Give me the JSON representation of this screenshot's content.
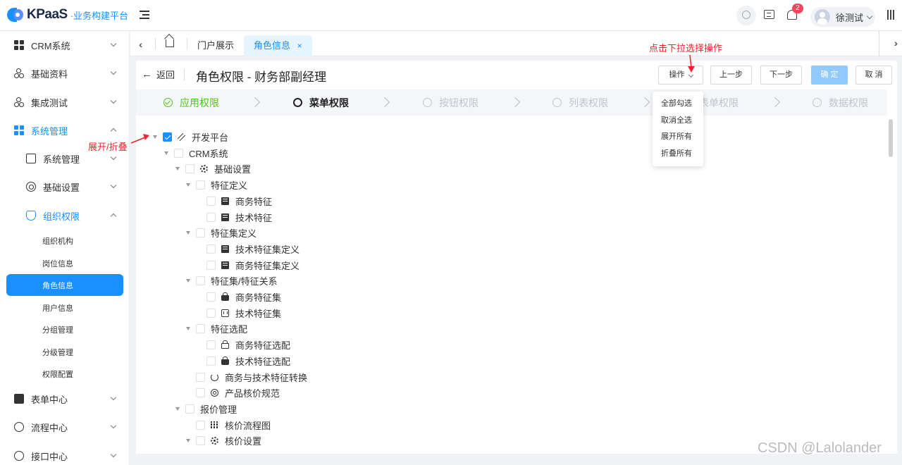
{
  "header": {
    "logo_text": "KPaaS",
    "logo_sub": "·业务构建平台",
    "notification_count": "2",
    "user_name": "徐测试"
  },
  "sidebar": {
    "items": [
      {
        "label": "CRM系统",
        "icon": "grid-icon"
      },
      {
        "label": "基础资料",
        "icon": "nodes-icon"
      },
      {
        "label": "集成测试",
        "icon": "nodes-icon"
      },
      {
        "label": "系统管理",
        "icon": "grid-icon",
        "expanded": true
      },
      {
        "label": "系统管理",
        "icon": "monitor-icon"
      },
      {
        "label": "基础设置",
        "icon": "gear-icon"
      },
      {
        "label": "组织权限",
        "icon": "shield-icon",
        "expanded": true
      },
      {
        "label": "表单中心",
        "icon": "document-icon"
      },
      {
        "label": "流程中心",
        "icon": "flow-icon"
      },
      {
        "label": "接口中心",
        "icon": "interface-icon"
      }
    ],
    "leaves": [
      "组织机构",
      "岗位信息",
      "角色信息",
      "用户信息",
      "分组管理",
      "分级管理",
      "权限配置"
    ],
    "active_leaf": "角色信息"
  },
  "tabs": {
    "items": [
      {
        "label": "门户展示"
      },
      {
        "label": "角色信息",
        "active": true,
        "close": "×"
      }
    ]
  },
  "page": {
    "back_label": "返回",
    "title": "角色权限 - 财务部副经理",
    "action_label": "操作",
    "prev_label": "上一步",
    "next_label": "下一步",
    "confirm_label": "确 定",
    "cancel_label": "取 消"
  },
  "steps": [
    {
      "label": "应用权限",
      "state": "done"
    },
    {
      "label": "菜单权限",
      "state": "current"
    },
    {
      "label": "按钮权限",
      "state": "pending"
    },
    {
      "label": "列表权限",
      "state": "pending"
    },
    {
      "label": "表单权限",
      "state": "pending"
    },
    {
      "label": "数据权限",
      "state": "pending"
    }
  ],
  "dropdown": {
    "items": [
      "全部勾选",
      "取消全选",
      "展开所有",
      "折叠所有"
    ]
  },
  "tree": [
    {
      "label": "开发平台",
      "level": 0,
      "checked": true,
      "expandable": true,
      "icon": "pen-icon"
    },
    {
      "label": "CRM系统",
      "level": 1,
      "expandable": true
    },
    {
      "label": "基础设置",
      "level": 2,
      "expandable": true,
      "icon": "gear-icon"
    },
    {
      "label": "特征定义",
      "level": 3,
      "expandable": true
    },
    {
      "label": "商务特征",
      "level": 4,
      "icon": "list-icon"
    },
    {
      "label": "技术特征",
      "level": 4,
      "icon": "list-icon"
    },
    {
      "label": "特征集定义",
      "level": 3,
      "expandable": true
    },
    {
      "label": "技术特征集定义",
      "level": 4,
      "icon": "list-icon"
    },
    {
      "label": "商务特征集定义",
      "level": 4,
      "icon": "list-icon"
    },
    {
      "label": "特征集/特征关系",
      "level": 3,
      "expandable": true
    },
    {
      "label": "商务特征集",
      "level": 4,
      "icon": "bag-icon"
    },
    {
      "label": "技术特征集",
      "level": 4,
      "icon": "card-icon"
    },
    {
      "label": "特征选配",
      "level": 3,
      "expandable": true
    },
    {
      "label": "商务特征选配",
      "level": 4,
      "icon": "bag-outline-icon"
    },
    {
      "label": "技术特征选配",
      "level": 4,
      "icon": "bag-icon"
    },
    {
      "label": "商务与技术特征转换",
      "level": 3,
      "icon": "sync-icon"
    },
    {
      "label": "产品核价规范",
      "level": 3,
      "icon": "ring-icon"
    },
    {
      "label": "报价管理",
      "level": 2,
      "expandable": true
    },
    {
      "label": "核价流程图",
      "level": 3,
      "icon": "dots-icon"
    },
    {
      "label": "核价设置",
      "level": 3,
      "expandable": true,
      "icon": "gear-icon"
    }
  ],
  "annotations": {
    "dropdown_hint": "点击下拉选择操作",
    "toggle_hint": "展开/折叠"
  },
  "watermark": "CSDN @Lalolander",
  "colors": {
    "primary": "#1890ff",
    "success": "#52c41a",
    "annotation": "#f5222d",
    "badge": "#f5455c"
  }
}
